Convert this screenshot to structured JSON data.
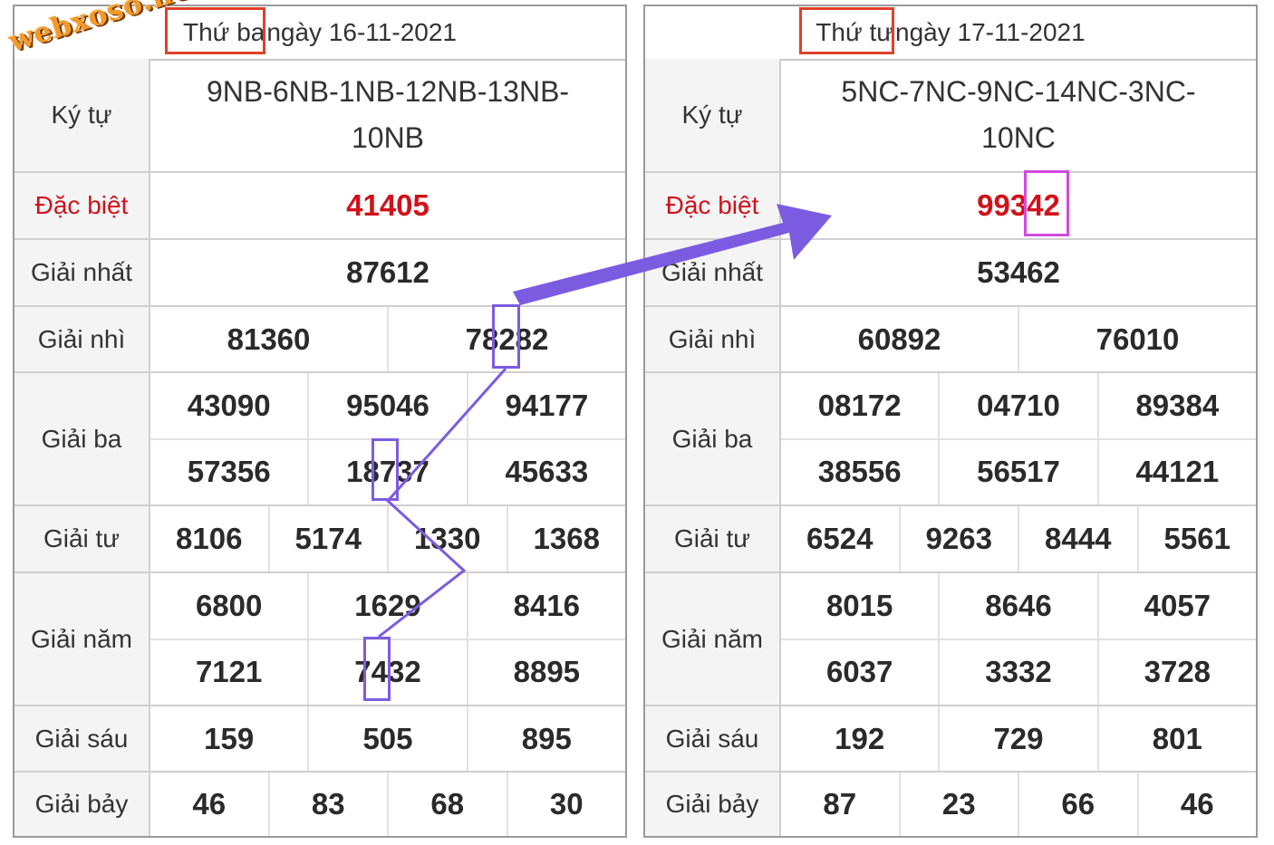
{
  "watermark": "webxoso.net",
  "left": {
    "weekday": "Thứ ba",
    "date_text": "ngày 16-11-2021",
    "labels": {
      "ky_tu": "Ký tự",
      "dac_biet": "Đặc biệt",
      "nhat": "Giải nhất",
      "nhi": "Giải nhì",
      "ba": "Giải ba",
      "tu": "Giải tư",
      "nam": "Giải năm",
      "sau": "Giải sáu",
      "bay": "Giải bảy"
    },
    "ky_tu": "9NB-6NB-1NB-12NB-13NB-10NB",
    "dac_biet": "41405",
    "giai_nhat": "87612",
    "giai_nhi": [
      "81360",
      "78282"
    ],
    "giai_ba": [
      "43090",
      "95046",
      "94177",
      "57356",
      "18737",
      "45633"
    ],
    "giai_tu": [
      "8106",
      "5174",
      "1330",
      "1368"
    ],
    "giai_nam": [
      "6800",
      "1629",
      "8416",
      "7121",
      "7432",
      "8895"
    ],
    "giai_sau": [
      "159",
      "505",
      "895"
    ],
    "giai_bay": [
      "46",
      "83",
      "68",
      "30"
    ]
  },
  "right": {
    "weekday": "Thứ tư",
    "date_text": "ngày 17-11-2021",
    "labels": {
      "ky_tu": "Ký tự",
      "dac_biet": "Đặc biệt",
      "nhat": "Giải nhất",
      "nhi": "Giải nhì",
      "ba": "Giải ba",
      "tu": "Giải tư",
      "nam": "Giải năm",
      "sau": "Giải sáu",
      "bay": "Giải bảy"
    },
    "ky_tu": "5NC-7NC-9NC-14NC-3NC-10NC",
    "dac_biet": "99342",
    "giai_nhat": "53462",
    "giai_nhi": [
      "60892",
      "76010"
    ],
    "giai_ba": [
      "08172",
      "04710",
      "89384",
      "38556",
      "56517",
      "44121"
    ],
    "giai_tu": [
      "6524",
      "9263",
      "8444",
      "5561"
    ],
    "giai_nam": [
      "8015",
      "8646",
      "4057",
      "6037",
      "3332",
      "3728"
    ],
    "giai_sau": [
      "192",
      "729",
      "801"
    ],
    "giai_bay": [
      "87",
      "23",
      "66",
      "46"
    ]
  },
  "colors": {
    "special": "#d0121b",
    "marker_red": "#e0402a",
    "marker_purple": "#7b5ce0",
    "marker_pink": "#d24ae0"
  }
}
